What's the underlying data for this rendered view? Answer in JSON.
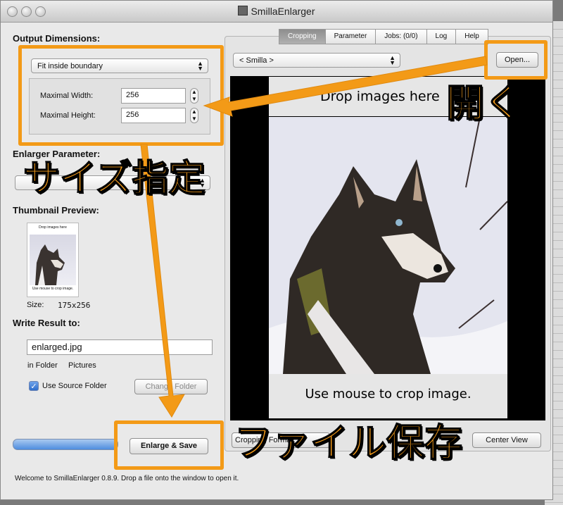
{
  "window": {
    "title": "SmillaEnlarger"
  },
  "left": {
    "output_dimensions_label": "Output Dimensions:",
    "mode": "Fit inside boundary",
    "max_width_label": "Maximal Width:",
    "max_width": "256",
    "max_height_label": "Maximal Height:",
    "max_height": "256",
    "enlarger_parameter_label": "Enlarger Parameter:",
    "thumbnail_label": "Thumbnail Preview:",
    "size_label": "Size:",
    "size_value": "175x256",
    "write_result_label": "Write Result to:",
    "filename": "enlarged.jpg",
    "in_folder_label": "in Folder",
    "folder_value": "Pictures",
    "use_source_folder_label": "Use Source Folder",
    "use_source_folder_checked": true,
    "change_folder_label": "Change Folder",
    "enlarge_save_label": "Enlarge & Save"
  },
  "tabs": [
    "Cropping",
    "Parameter",
    "Jobs: (0/0)",
    "Log",
    "Help"
  ],
  "active_tab": "Cropping",
  "right": {
    "preset": "< Smilla >",
    "open_label": "Open...",
    "drop_hint": "Drop images here",
    "crop_hint": "Use mouse to crop image.",
    "crop_format_label": "Cropping Format",
    "center_view_label": "Center View"
  },
  "status": "Welcome to SmillaEnlarger 0.8.9.  Drop a file onto the window to open it.",
  "annotations": {
    "open": "開く",
    "size": "サイズ指定",
    "save": "ファイル保存"
  },
  "colors": {
    "annotation": "#f39a17"
  },
  "thumbnail": {
    "drop_text": "Drop images here",
    "crop_text": "Use mouse to crop image."
  }
}
